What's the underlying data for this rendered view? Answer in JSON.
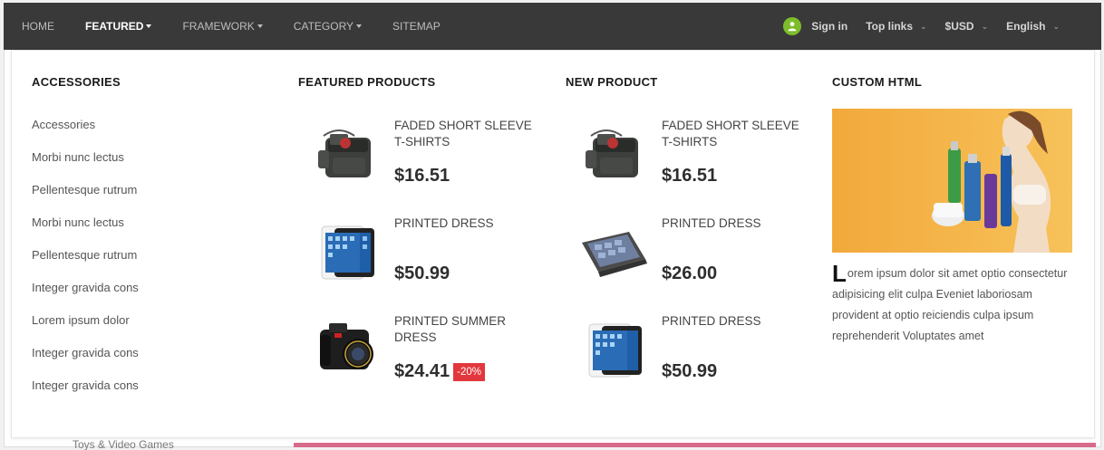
{
  "nav": {
    "items": [
      {
        "label": "HOME",
        "caret": false,
        "active": false
      },
      {
        "label": "FEATURED",
        "caret": true,
        "active": true
      },
      {
        "label": "FRAMEWORK",
        "caret": true,
        "active": false
      },
      {
        "label": "CATEGORY",
        "caret": true,
        "active": false
      },
      {
        "label": "SITEMAP",
        "caret": false,
        "active": false
      }
    ],
    "sign_in": "Sign in",
    "top_links": "Top links",
    "currency": "$USD",
    "language": "English"
  },
  "accessories": {
    "title": "ACCESSORIES",
    "items": [
      "Accessories",
      "Morbi nunc lectus",
      "Pellentesque rutrum",
      "Morbi nunc lectus",
      "Pellentesque rutrum",
      "Integer gravida cons",
      "Lorem ipsum dolor",
      "Integer gravida cons",
      "Integer gravida cons"
    ]
  },
  "featured": {
    "title": "FEATURED PRODUCTS",
    "products": [
      {
        "name": "FADED SHORT SLEEVE T-SHIRTS",
        "price": "$16.51",
        "badge": "",
        "image": "camera-bag"
      },
      {
        "name": "PRINTED DRESS",
        "price": "$50.99",
        "badge": "",
        "image": "tablet"
      },
      {
        "name": "PRINTED SUMMER DRESS",
        "price": "$24.41",
        "badge": "-20%",
        "image": "dslr-camera"
      }
    ]
  },
  "new_product": {
    "title": "NEW PRODUCT",
    "products": [
      {
        "name": "FADED SHORT SLEEVE T-SHIRTS",
        "price": "$16.51",
        "badge": "",
        "image": "camera-bag"
      },
      {
        "name": "PRINTED DRESS",
        "price": "$26.00",
        "badge": "",
        "image": "convertible-laptop"
      },
      {
        "name": "PRINTED DRESS",
        "price": "$50.99",
        "badge": "",
        "image": "tablet"
      }
    ]
  },
  "custom": {
    "title": "CUSTOM HTML",
    "dropcap": "L",
    "text": "orem ipsum dolor sit amet optio consectetur adipisicing elit culpa Eveniet laboriosam provident at optio reiciendis culpa ipsum reprehenderit Voluptates amet"
  },
  "background": {
    "partial_text": "Toys & Video Games"
  },
  "colors": {
    "navbar": "#393939",
    "sign_in_icon": "#7dbd2b",
    "discount_badge": "#e2383d",
    "banner_bg": "#f2a93b"
  }
}
